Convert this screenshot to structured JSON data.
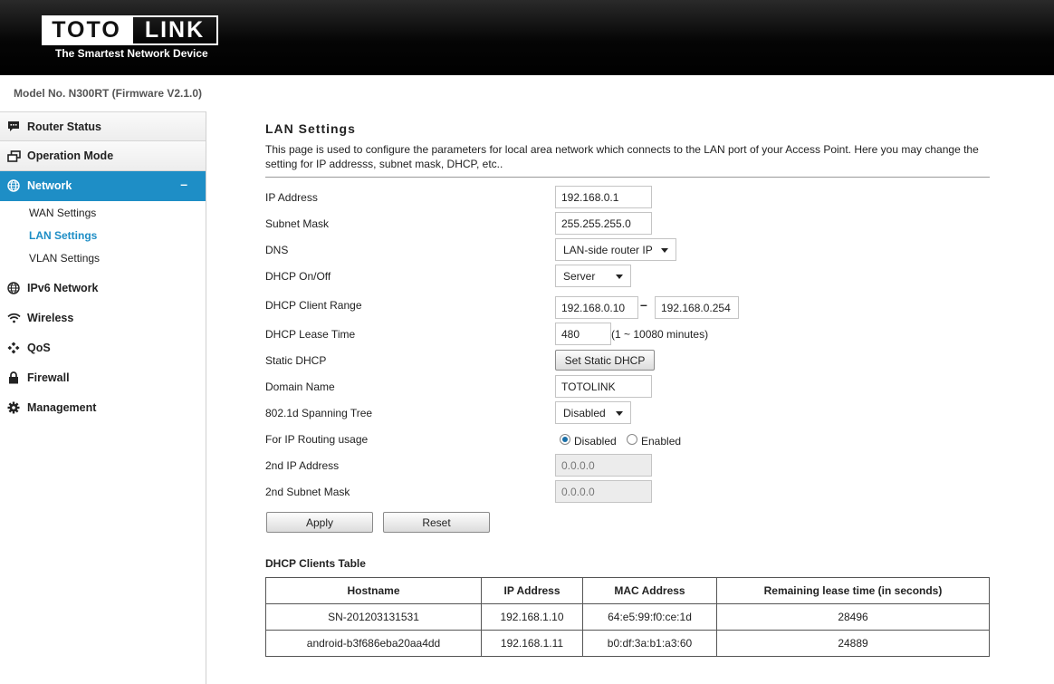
{
  "header": {
    "logo_left": "TOTO",
    "logo_right": "LINK",
    "tagline": "The Smartest Network Device"
  },
  "model": "Model No. N300RT (Firmware V2.1.0)",
  "sidebar": {
    "items": [
      {
        "label": "Router Status",
        "icon": "chat-bubble-icon"
      },
      {
        "label": "Operation Mode",
        "icon": "windows-icon"
      },
      {
        "label": "Network",
        "icon": "globe-icon",
        "toggle": "–"
      },
      {
        "label": "IPv6 Network",
        "icon": "globe-icon"
      },
      {
        "label": "Wireless",
        "icon": "wifi-icon"
      },
      {
        "label": "QoS",
        "icon": "diamond-cluster-icon"
      },
      {
        "label": "Firewall",
        "icon": "lock-icon"
      },
      {
        "label": "Management",
        "icon": "gear-icon"
      }
    ],
    "network_sub": [
      "WAN Settings",
      "LAN Settings",
      "VLAN Settings"
    ]
  },
  "page": {
    "title": "LAN Settings",
    "description": "This page is used to configure the parameters for local area network which connects to the LAN port of your Access Point. Here you may change the setting for IP addresss, subnet mask, DHCP, etc.."
  },
  "form": {
    "ip_label": "IP Address",
    "ip_value": "192.168.0.1",
    "mask_label": "Subnet Mask",
    "mask_value": "255.255.255.0",
    "dns_label": "DNS",
    "dns_value": "LAN-side router IP",
    "dhcp_label": "DHCP On/Off",
    "dhcp_value": "Server",
    "range_label": "DHCP Client Range",
    "range_start": "192.168.0.10",
    "range_sep": "–",
    "range_end": "192.168.0.254",
    "lease_label": "DHCP Lease Time",
    "lease_value": "480",
    "lease_hint": "(1 ~ 10080 minutes)",
    "static_label": "Static DHCP",
    "static_button": "Set Static DHCP",
    "domain_label": "Domain Name",
    "domain_value": "TOTOLINK",
    "stp_label": "802.1d Spanning Tree",
    "stp_value": "Disabled",
    "routing_label": "For IP Routing usage",
    "routing_disabled": "Disabled",
    "routing_enabled": "Enabled",
    "ip2_label": "2nd IP Address",
    "ip2_value": "0.0.0.0",
    "mask2_label": "2nd Subnet Mask",
    "mask2_value": "0.0.0.0",
    "apply": "Apply",
    "reset": "Reset"
  },
  "dhcp_table": {
    "title": "DHCP Clients Table",
    "columns": [
      "Hostname",
      "IP Address",
      "MAC Address",
      "Remaining lease time (in seconds)"
    ],
    "rows": [
      [
        "SN-201203131531",
        "192.168.1.10",
        "64:e5:99:f0:ce:1d",
        "28496"
      ],
      [
        "android-b3f686eba20aa4dd",
        "192.168.1.11",
        "b0:df:3a:b1:a3:60",
        "24889"
      ]
    ]
  }
}
